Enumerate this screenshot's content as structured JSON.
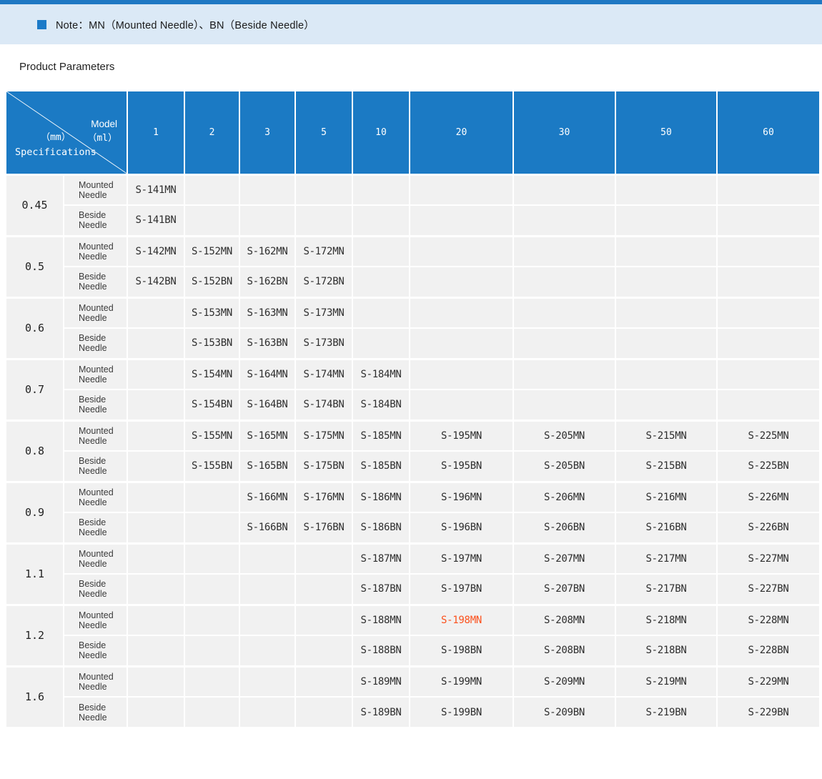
{
  "top_bar": {
    "color": "#1f78c3"
  },
  "note": {
    "text": "Note：MN（Mounted Needle）、BN（Beside Needle）"
  },
  "section_title": "Product Parameters",
  "table": {
    "corner": {
      "top_label": "Model",
      "top_unit": "（ml）",
      "bottom_unit": "（mm）",
      "bottom_label": "Specifications"
    },
    "columns": [
      "1",
      "2",
      "3",
      "5",
      "10",
      "20",
      "30",
      "50",
      "60"
    ],
    "row_labels": {
      "mounted": "Mounted Needle",
      "beside": "Beside Needle"
    },
    "groups": [
      {
        "spec": "0.45",
        "mounted": [
          "S-141MN",
          "",
          "",
          "",
          "",
          "",
          "",
          "",
          ""
        ],
        "beside": [
          "S-141BN",
          "",
          "",
          "",
          "",
          "",
          "",
          "",
          ""
        ]
      },
      {
        "spec": "0.5",
        "mounted": [
          "S-142MN",
          "S-152MN",
          "S-162MN",
          "S-172MN",
          "",
          "",
          "",
          "",
          ""
        ],
        "beside": [
          "S-142BN",
          "S-152BN",
          "S-162BN",
          "S-172BN",
          "",
          "",
          "",
          "",
          ""
        ]
      },
      {
        "spec": "0.6",
        "mounted": [
          "",
          "S-153MN",
          "S-163MN",
          "S-173MN",
          "",
          "",
          "",
          "",
          ""
        ],
        "beside": [
          "",
          "S-153BN",
          "S-163BN",
          "S-173BN",
          "",
          "",
          "",
          "",
          ""
        ]
      },
      {
        "spec": "0.7",
        "mounted": [
          "",
          "S-154MN",
          "S-164MN",
          "S-174MN",
          "S-184MN",
          "",
          "",
          "",
          ""
        ],
        "beside": [
          "",
          "S-154BN",
          "S-164BN",
          "S-174BN",
          "S-184BN",
          "",
          "",
          "",
          ""
        ]
      },
      {
        "spec": "0.8",
        "mounted": [
          "",
          "S-155MN",
          "S-165MN",
          "S-175MN",
          "S-185MN",
          "S-195MN",
          "S-205MN",
          "S-215MN",
          "S-225MN"
        ],
        "beside": [
          "",
          "S-155BN",
          "S-165BN",
          "S-175BN",
          "S-185BN",
          "S-195BN",
          "S-205BN",
          "S-215BN",
          "S-225BN"
        ]
      },
      {
        "spec": "0.9",
        "mounted": [
          "",
          "",
          "S-166MN",
          "S-176MN",
          "S-186MN",
          "S-196MN",
          "S-206MN",
          "S-216MN",
          "S-226MN"
        ],
        "beside": [
          "",
          "",
          "S-166BN",
          "S-176BN",
          "S-186BN",
          "S-196BN",
          "S-206BN",
          "S-216BN",
          "S-226BN"
        ]
      },
      {
        "spec": "1.1",
        "mounted": [
          "",
          "",
          "",
          "",
          "S-187MN",
          "S-197MN",
          "S-207MN",
          "S-217MN",
          "S-227MN"
        ],
        "beside": [
          "",
          "",
          "",
          "",
          "S-187BN",
          "S-197BN",
          "S-207BN",
          "S-217BN",
          "S-227BN"
        ]
      },
      {
        "spec": "1.2",
        "mounted": [
          "",
          "",
          "",
          "",
          "S-188MN",
          "S-198MN",
          "S-208MN",
          "S-218MN",
          "S-228MN"
        ],
        "beside": [
          "",
          "",
          "",
          "",
          "S-188BN",
          "S-198BN",
          "S-208BN",
          "S-218BN",
          "S-228BN"
        ]
      },
      {
        "spec": "1.6",
        "mounted": [
          "",
          "",
          "",
          "",
          "S-189MN",
          "S-199MN",
          "S-209MN",
          "S-219MN",
          "S-229MN"
        ],
        "beside": [
          "",
          "",
          "",
          "",
          "S-189BN",
          "S-199BN",
          "S-209BN",
          "S-219BN",
          "S-229BN"
        ]
      }
    ],
    "highlight": {
      "spec": "1.2",
      "row": "mounted",
      "col_index": 5,
      "code": "S-198MN",
      "color": "#fb511d"
    },
    "colors": {
      "header_bg": "#1b7ac4",
      "cell_bg": "#f1f1f1",
      "border": "#ffffff"
    }
  }
}
